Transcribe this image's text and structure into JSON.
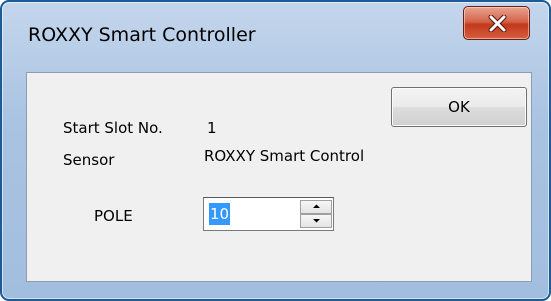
{
  "window": {
    "title": "ROXXY Smart Controller",
    "frame_color": "#1e5a96",
    "close_button_color": "#c2391c"
  },
  "icons": {
    "close": "close-icon",
    "spin_up": "arrow-up-icon",
    "spin_down": "arrow-down-icon"
  },
  "buttons": {
    "ok_label": "OK"
  },
  "info": {
    "start_slot_label": "Start Slot No.",
    "start_slot_value": "1",
    "sensor_label": "Sensor",
    "sensor_value": "ROXXY Smart Control"
  },
  "pole": {
    "label": "POLE",
    "value": "10",
    "selection_color": "#3399ff"
  }
}
